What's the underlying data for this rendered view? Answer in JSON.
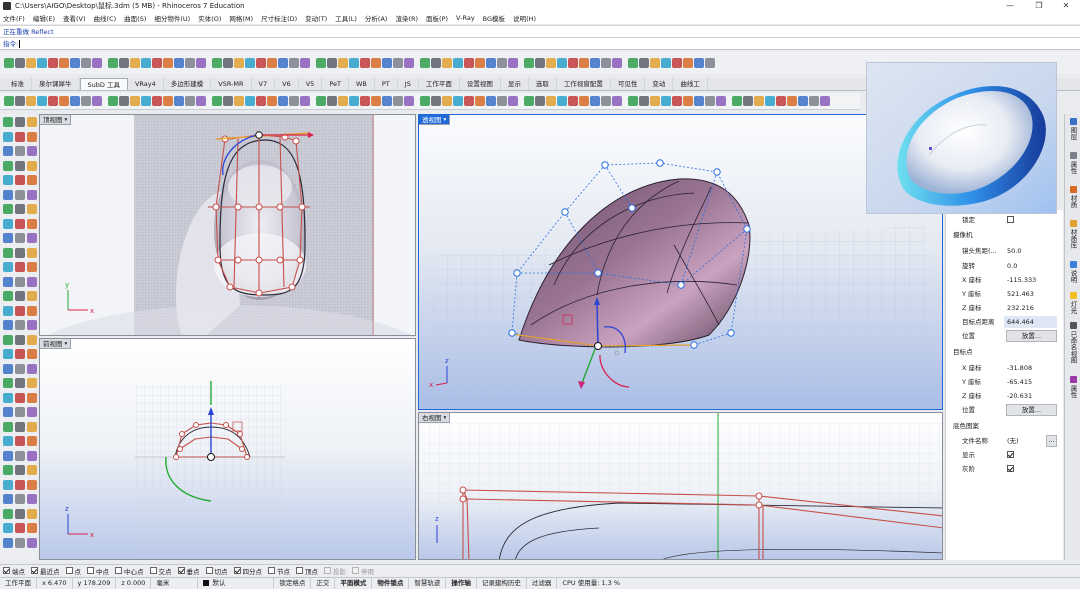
{
  "window": {
    "title": "C:\\Users\\AIGO\\Desktop\\鼠标.3dm (5 MB) - Rhinoceros 7 Education",
    "minimize": "—",
    "maximize": "❐",
    "close": "✕"
  },
  "menu": [
    "文件(F)",
    "编辑(E)",
    "查看(V)",
    "曲线(C)",
    "曲面(S)",
    "细分物件(U)",
    "实体(O)",
    "网格(M)",
    "尺寸标注(D)",
    "变动(T)",
    "工具(L)",
    "分析(A)",
    "渲染(R)",
    "面板(P)",
    "V-Ray",
    "BG模板",
    "说明(H)"
  ],
  "command": {
    "history": "正在重做 Reflect",
    "prompt": "指令:"
  },
  "tabs": [
    "标准",
    "泉尔课犀牛",
    "SubD 工具",
    "VRay4",
    "多边形建模",
    "VSR-MR",
    "V7",
    "V6",
    "V5",
    "PeT",
    "WB",
    "PT",
    "JS",
    "工作平面",
    "设置视图",
    "显示",
    "选取",
    "工作视窗配置",
    "可见性",
    "变动",
    "曲线工"
  ],
  "active_tab": "SubD 工具",
  "viewports": {
    "top": {
      "label": "顶视图"
    },
    "persp": {
      "label": "透视图"
    },
    "front": {
      "label": "前视图"
    },
    "right": {
      "label": "右视图"
    }
  },
  "axis": {
    "x": "x",
    "y": "y",
    "z": "z"
  },
  "properties": {
    "lock_label": "锁定",
    "camera_section": "摄像机",
    "lens_label": "镜头焦距(...",
    "lens_value": "50.0",
    "rotation_label": "旋转",
    "rotation_value": "0.0",
    "cam_x_label": "X 座标",
    "cam_x": "-115.333",
    "cam_y_label": "Y 座标",
    "cam_y": "521.463",
    "cam_z_label": "Z 座标",
    "cam_z": "232.216",
    "target_dist_label": "目标点距离",
    "target_dist": "644.464",
    "position_label": "位置",
    "place_button": "放置...",
    "target_section": "目标点",
    "tgt_x_label": "X 座标",
    "tgt_x": "-31.808",
    "tgt_y_label": "Y 座标",
    "tgt_y": "-65.415",
    "tgt_z_label": "Z 座标",
    "tgt_z": "-20.631",
    "tgt_position_label": "位置",
    "tgt_place_button": "放置...",
    "wallpaper_section": "底色图案",
    "filename_label": "文件名称",
    "filename_value": "(无)",
    "browse_button": "...",
    "show_label": "显示",
    "gray_label": "灰阶"
  },
  "right_tabs": [
    "图层",
    "属性",
    "材质",
    "材质库",
    "说明",
    "灯光",
    "已命名视图",
    "属性"
  ],
  "osnap": [
    {
      "label": "端点",
      "on": true
    },
    {
      "label": "最近点",
      "on": true
    },
    {
      "label": "点",
      "on": false
    },
    {
      "label": "中点",
      "on": false
    },
    {
      "label": "中心点",
      "on": false
    },
    {
      "label": "交点",
      "on": false
    },
    {
      "label": "垂点",
      "on": true
    },
    {
      "label": "切点",
      "on": false
    },
    {
      "label": "四分点",
      "on": true
    },
    {
      "label": "节点",
      "on": false
    },
    {
      "label": "顶点",
      "on": false
    },
    {
      "label": "投影",
      "on": false,
      "disabled": true
    },
    {
      "label": "停用",
      "on": false,
      "disabled": true
    }
  ],
  "status": {
    "cplane": "工作平面",
    "x": "x 6.470",
    "y": "y 178.209",
    "z": "z 0.000",
    "unit": "毫米",
    "layer": "默认",
    "grid_snap": "锁定格点",
    "ortho": "正交",
    "planar": "平面模式",
    "osnap": "物件锁点",
    "smarttrack": "智慧轨迹",
    "gumball": "操作轴",
    "history": "记录建构历史",
    "filter": "过滤器",
    "cpu": "CPU 使用量: 1.3 %"
  },
  "colors": {
    "accent": "#1f6ad8",
    "subd_edge": "#c6504a",
    "control_point": "#2a6fe0",
    "gumball_z": "#2b44d6",
    "gumball_y": "#22aa33",
    "gumball_x": "#d8204a"
  }
}
